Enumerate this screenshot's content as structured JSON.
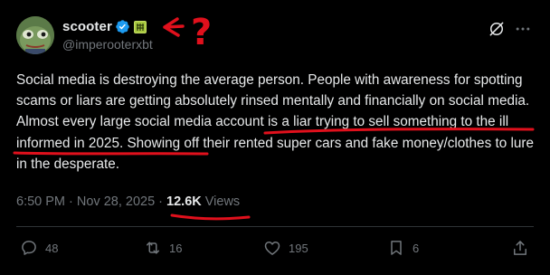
{
  "author": {
    "display_name": "scooter",
    "handle": "@imperooterxbt",
    "verified_badge": "verified-check-icon",
    "affiliate_badge": "affiliate-badge-icon"
  },
  "tweet": {
    "text": "Social media is destroying the average person. People with awareness for spotting scams or liars are getting absolutely rinsed mentally and financially on social media. Almost every large social media account is a liar trying to sell something to the ill informed in 2025. Showing off their rented super cars and fake money/clothes to lure in the desperate.",
    "timestamp": "6:50 PM · Nov 28, 2025 · ",
    "views_count": "12.6K",
    "views_label": " Views"
  },
  "actions": {
    "replies": "48",
    "reposts": "16",
    "likes": "195",
    "bookmarks": "6"
  },
  "annotation": {
    "question_mark": "?"
  },
  "colors": {
    "background": "#000000",
    "text": "#e7e9ea",
    "muted": "#71767b",
    "verified": "#1d9bf0",
    "annotation": "#e0101c"
  }
}
